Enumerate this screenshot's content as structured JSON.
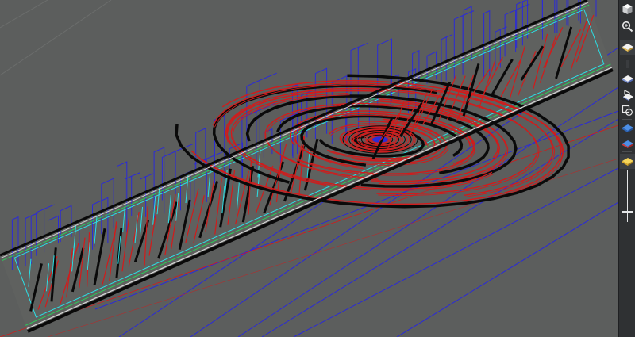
{
  "viewport": {
    "name": "3d-wireframe-viewport",
    "colors": {
      "background": "#5c5e5d",
      "outline": "#0a0a0a",
      "toolpath_primary": "#d21b1b",
      "stock_boundary": "#2b2bd6",
      "profile": "#2be0e6",
      "floor": "#2bcc58"
    }
  },
  "toolbar": {
    "buttons": [
      {
        "name": "view-cube-icon",
        "selected": false
      },
      {
        "name": "zoom-icon",
        "selected": false
      },
      {
        "name": "plane-yellow-icon",
        "selected": true
      },
      {
        "name": "plane-blue-icon",
        "selected": false
      },
      {
        "name": "section-view-icon",
        "selected": false
      },
      {
        "name": "stock-toggle-icon",
        "selected": false
      },
      {
        "name": "layer-blue-icon",
        "selected": false
      },
      {
        "name": "layer-red-icon",
        "selected": false
      },
      {
        "name": "layer-yellow-icon",
        "selected": true
      }
    ],
    "zoom_level": 0.85
  }
}
